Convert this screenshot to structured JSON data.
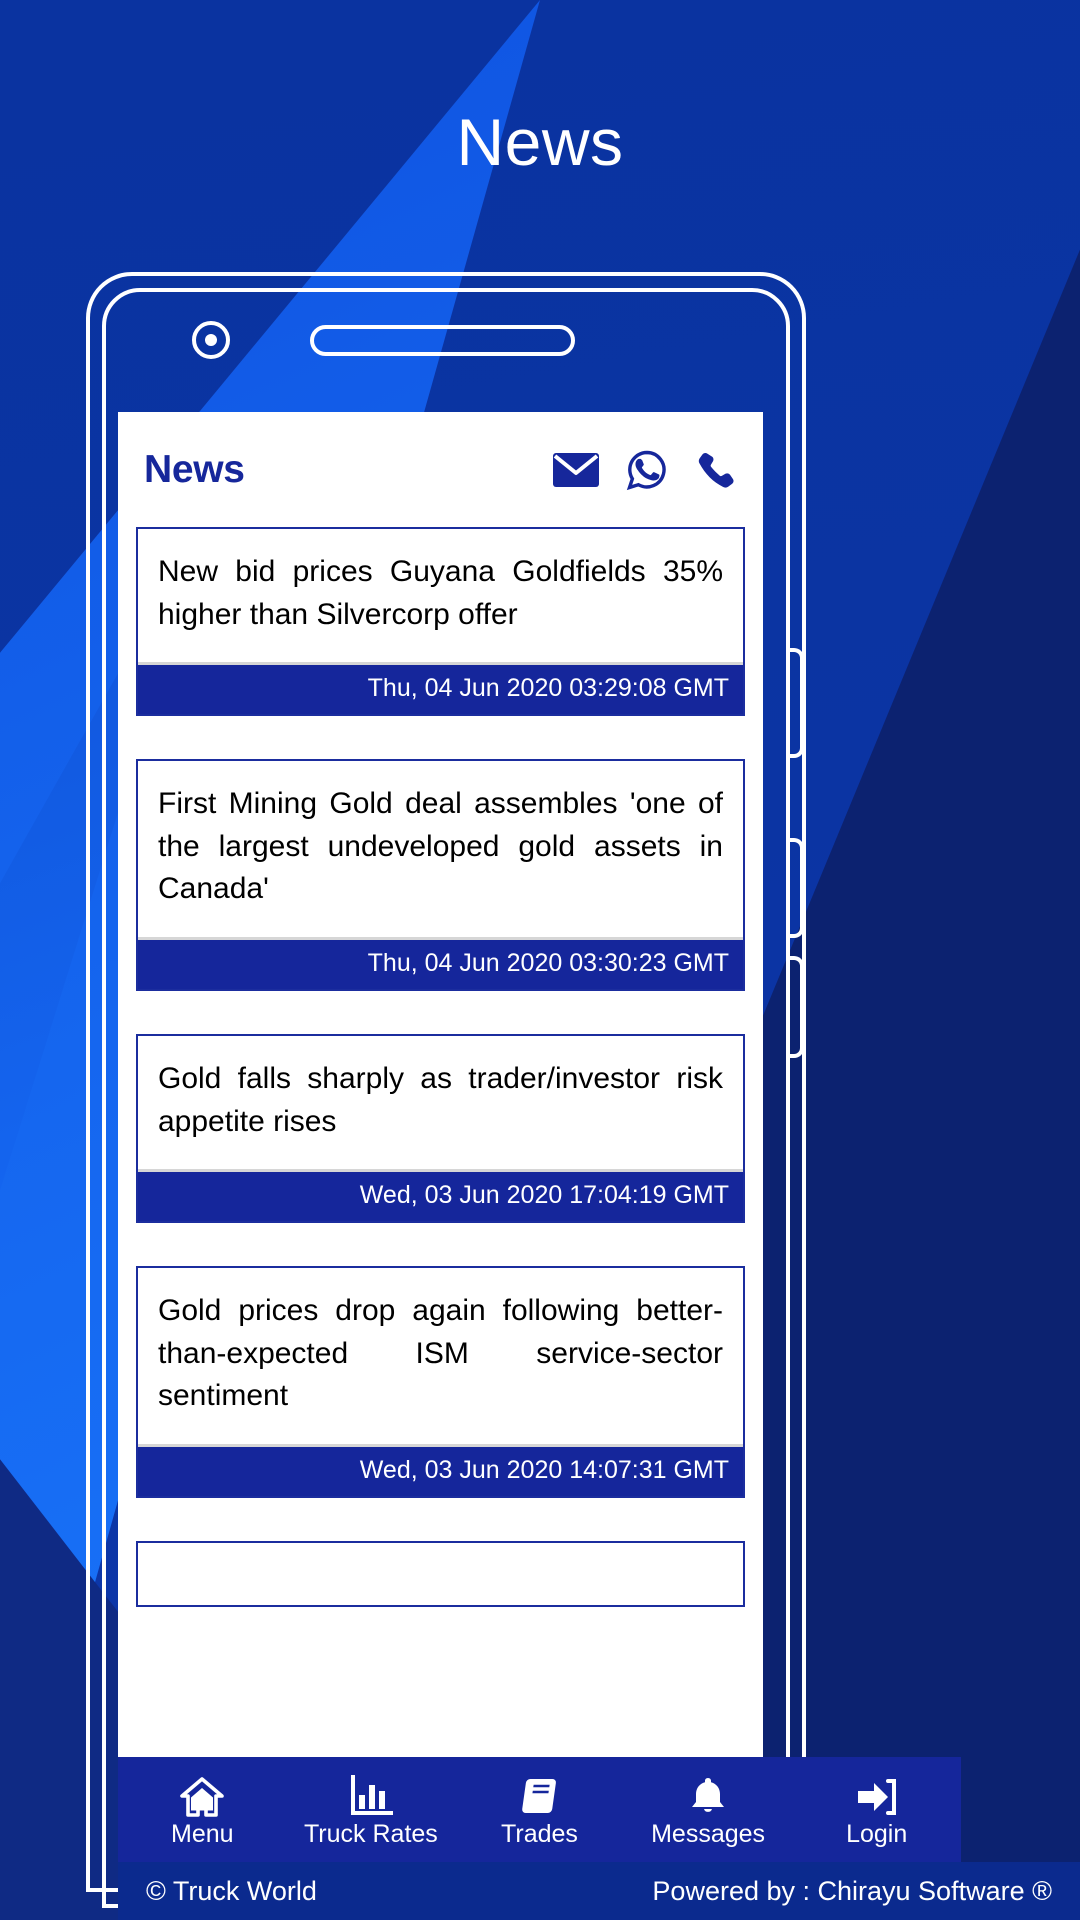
{
  "page": {
    "title": "News",
    "background_color": "#0a33a0",
    "accent_color": "#15269b",
    "light_blue": "#1b7cff",
    "dark_navy": "#0c2270"
  },
  "device": {
    "camera_icon": "camera-icon",
    "speaker_icon": "speaker-grille-icon"
  },
  "app": {
    "header": {
      "title": "News",
      "icons": [
        {
          "name": "email-icon",
          "label": "Email"
        },
        {
          "name": "whatsapp-icon",
          "label": "WhatsApp"
        },
        {
          "name": "phone-icon",
          "label": "Phone"
        }
      ]
    },
    "news_items": [
      {
        "headline": "New bid prices Guyana Goldfields 35% higher than Silvercorp offer",
        "date": "Thu, 04 Jun 2020 03:29:08 GMT"
      },
      {
        "headline": "First Mining Gold deal assembles 'one of the largest undeveloped gold assets in Canada'",
        "date": "Thu, 04 Jun 2020 03:30:23 GMT"
      },
      {
        "headline": "Gold falls sharply as trader/investor risk appetite rises",
        "date": "Wed, 03 Jun 2020 17:04:19 GMT"
      },
      {
        "headline": "Gold prices drop again following better-than-expected ISM service-sector sentiment",
        "date": "Wed, 03 Jun 2020 14:07:31 GMT"
      },
      {
        "headline": "",
        "date": ""
      }
    ]
  },
  "bottom_nav": {
    "items": [
      {
        "label": "Menu",
        "icon": "home-icon"
      },
      {
        "label": "Truck Rates",
        "icon": "bar-chart-icon"
      },
      {
        "label": "Trades",
        "icon": "book-icon"
      },
      {
        "label": "Messages",
        "icon": "bell-icon"
      },
      {
        "label": "Login",
        "icon": "sign-in-icon"
      }
    ]
  },
  "footer": {
    "left": "© Truck World",
    "right": "Powered by : Chirayu Software ®"
  }
}
